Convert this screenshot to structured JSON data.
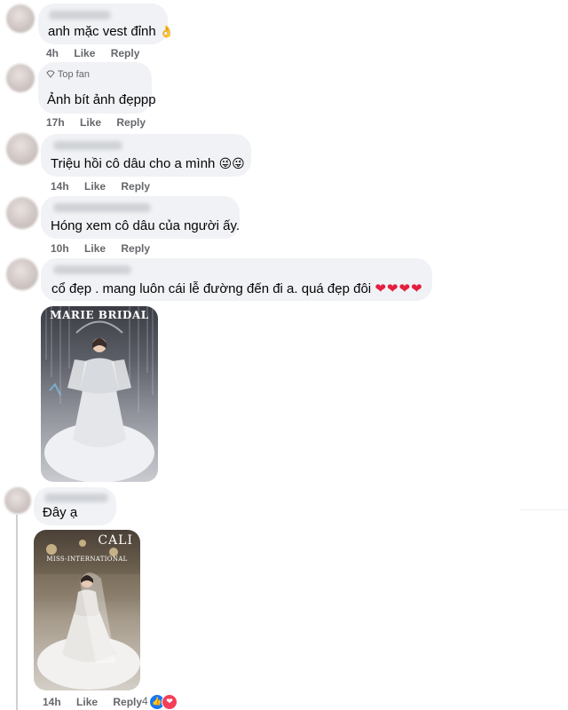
{
  "comments": [
    {
      "text": "anh mặc vest đỉnh",
      "emoji": "👌",
      "time": "4h",
      "like": "Like",
      "reply": "Reply"
    },
    {
      "badge": "Top fan",
      "text": "Ảnh bít ảnh đẹppp",
      "time": "17h",
      "like": "Like",
      "reply": "Reply"
    },
    {
      "text": "Triệu hồi cô dâu cho a mình",
      "emoji": "😜😜",
      "time": "14h",
      "like": "Like",
      "reply": "Reply"
    },
    {
      "text": "Hóng xem cô dâu của người ấy.",
      "time": "10h",
      "like": "Like",
      "reply": "Reply"
    },
    {
      "text": "cổ đẹp . mang luôn cái lễ đường đến đi a. quá đẹp đôi",
      "emoji": "❤❤❤❤",
      "photo_caption": "MARIE BRIDAL"
    },
    {
      "text": "Đây ạ",
      "photo_brand": "CALI",
      "photo_subtitle": "MISS-INTERNATIONAL",
      "time": "14h",
      "like": "Like",
      "reply": "Reply",
      "reaction_count": "4",
      "reactions": [
        "like-icon",
        "love-icon"
      ]
    }
  ],
  "colors": {
    "bubble": "#f0f2f5",
    "meta": "#65676b",
    "like_blue": "#1877f2",
    "love_red": "#f33e58"
  }
}
